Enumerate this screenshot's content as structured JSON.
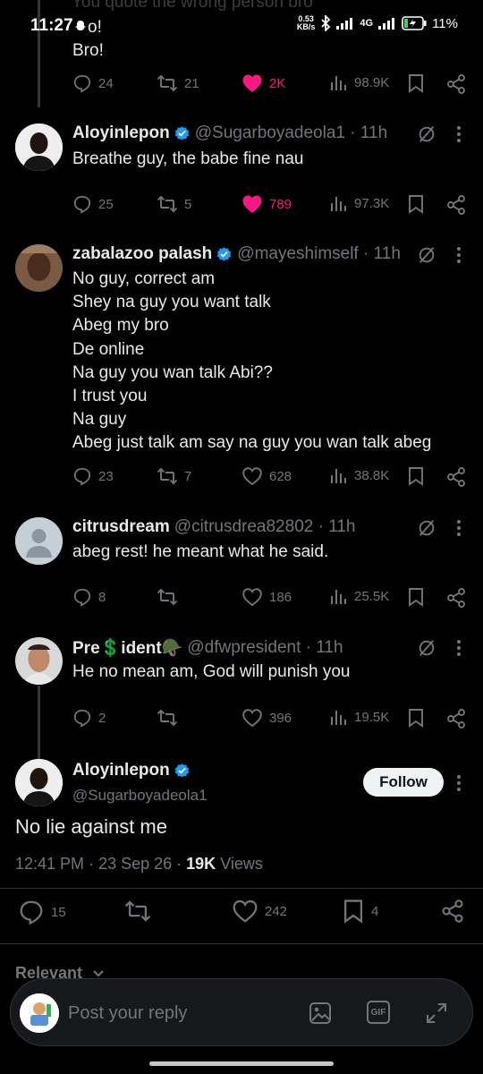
{
  "status_bar": {
    "time": "11:27",
    "speed_value": "0.53",
    "speed_unit": "KB/s",
    "network": "4G",
    "battery": "11%"
  },
  "prev_tweet": {
    "ghost_line": "You quote the wrong person bro",
    "text_tail": "o!",
    "text": "Bro!",
    "replies": "24",
    "reposts": "21",
    "likes": "2K",
    "views": "98.9K"
  },
  "replies": [
    {
      "name": "Aloyinlepon",
      "handle": "@Sugarboyadeola1 · 11h",
      "text": "Breathe guy, the babe fine nau",
      "replies": "25",
      "reposts": "5",
      "likes": "789",
      "views": "97.3K",
      "liked": true,
      "verified": true
    },
    {
      "name": "zabalazoo palash",
      "handle": "@mayeshimself · 11h",
      "text": "No guy, correct am\nShey na guy you want talk\nAbeg my bro\nDe online\nNa guy you wan talk Abi??\nI trust you\nNa guy\nAbeg just talk am say na guy you wan talk abeg",
      "replies": "23",
      "reposts": "7",
      "likes": "628",
      "views": "38.8K",
      "liked": false,
      "verified": true
    },
    {
      "name": "citrusdream",
      "handle": "@citrusdrea82802 · 11h",
      "text": "abeg rest! he meant what he said.",
      "replies": "8",
      "reposts": "",
      "likes": "186",
      "views": "25.5K",
      "liked": false,
      "verified": false
    },
    {
      "name": "Pre💲ident🪖",
      "handle": "@dfwpresident · 11h",
      "text": "He no mean am, God will punish you",
      "replies": "2",
      "reposts": "",
      "likes": "396",
      "views": "19.5K",
      "liked": false,
      "verified": false
    }
  ],
  "main_tweet": {
    "name": "Aloyinlepon",
    "handle": "@Sugarboyadeola1",
    "follow_label": "Follow",
    "text": "No lie against me",
    "time": "12:41 PM",
    "date": "23 Sep 26",
    "views_count": "19K",
    "views_label": "Views",
    "replies": "15",
    "likes": "242",
    "bookmarks": "4"
  },
  "relevant_label": "Relevant",
  "composer": {
    "placeholder": "Post your reply",
    "gif_label": "GIF"
  },
  "colors": {
    "accent_blue": "#1d9bf0",
    "like_pink": "#f91880",
    "muted": "#71767b",
    "background": "#000000"
  }
}
